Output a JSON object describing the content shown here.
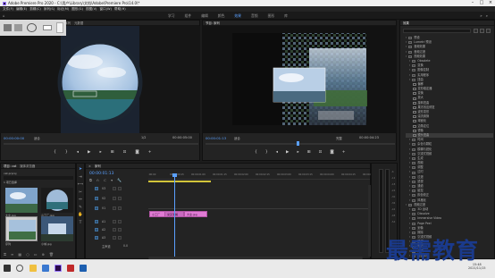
{
  "app": {
    "title": "Adobe Premiere Pro 2020 - C:\\用户\\Library\\文档\\Adobe\\Premiere Pro\\14.0\\*",
    "menu": [
      "文件(F)",
      "编辑(E)",
      "剪辑(C)",
      "序列(S)",
      "标记(M)",
      "图形(G)",
      "视图(V)",
      "窗口(W)",
      "帮助(H)"
    ]
  },
  "workspaces": {
    "tabs": [
      "学习",
      "组件",
      "编辑",
      "颜色",
      "效果",
      "音频",
      "图形",
      "库"
    ],
    "active_index": 4
  },
  "source": {
    "tabs": [
      "源：(无剪辑)",
      "效果控件",
      "音频剪辑混合器：序列",
      "元数据"
    ],
    "timecode_left": "00:00:00:00",
    "fit": "适合",
    "fraction": "1/2",
    "timecode_right": "00:00:05:00"
  },
  "program": {
    "tab": "节目: 序列",
    "timecode_left": "00:00:01:13",
    "fit": "适合",
    "fraction": "完整",
    "timecode_right": "00:00:04:23"
  },
  "effects": {
    "tab": "效果",
    "tree": [
      {
        "label": "预设",
        "kind": "folder",
        "level": 0
      },
      {
        "label": "Lumetri 预设",
        "kind": "folder",
        "level": 0
      },
      {
        "label": "音频效果",
        "kind": "folder",
        "level": 0
      },
      {
        "label": "音频过渡",
        "kind": "folder",
        "level": 0
      },
      {
        "label": "视频效果",
        "kind": "folder",
        "level": 0
      },
      {
        "label": "Obsolete",
        "kind": "folder",
        "level": 1
      },
      {
        "label": "变换",
        "kind": "folder",
        "level": 1
      },
      {
        "label": "图像控制",
        "kind": "folder",
        "level": 1
      },
      {
        "label": "实用程序",
        "kind": "folder",
        "level": 1
      },
      {
        "label": "扭曲",
        "kind": "folder",
        "level": 1
      },
      {
        "label": "偏移",
        "kind": "item",
        "level": 2
      },
      {
        "label": "变形稳定器",
        "kind": "item",
        "level": 2
      },
      {
        "label": "变换",
        "kind": "item",
        "level": 2
      },
      {
        "label": "放大",
        "kind": "item",
        "level": 2
      },
      {
        "label": "旋转扭曲",
        "kind": "item",
        "level": 2
      },
      {
        "label": "果冻效应修复",
        "kind": "item",
        "level": 2
      },
      {
        "label": "波形变形",
        "kind": "item",
        "level": 2
      },
      {
        "label": "湍流置换",
        "kind": "item",
        "level": 2
      },
      {
        "label": "球面化",
        "kind": "item",
        "level": 2
      },
      {
        "label": "边角定位",
        "kind": "item",
        "level": 2
      },
      {
        "label": "镜像",
        "kind": "item",
        "level": 2
      },
      {
        "label": "镜头扭曲",
        "kind": "item",
        "level": 2,
        "selected": true
      },
      {
        "label": "时间",
        "kind": "folder",
        "level": 1
      },
      {
        "label": "杂色与颗粒",
        "kind": "folder",
        "level": 1
      },
      {
        "label": "模糊与锐化",
        "kind": "folder",
        "level": 1
      },
      {
        "label": "沉浸式视频",
        "kind": "folder",
        "level": 1
      },
      {
        "label": "生成",
        "kind": "folder",
        "level": 1
      },
      {
        "label": "视频",
        "kind": "folder",
        "level": 1
      },
      {
        "label": "调整",
        "kind": "folder",
        "level": 1
      },
      {
        "label": "过时",
        "kind": "folder",
        "level": 1
      },
      {
        "label": "过渡",
        "kind": "folder",
        "level": 1
      },
      {
        "label": "透视",
        "kind": "folder",
        "level": 1
      },
      {
        "label": "通道",
        "kind": "folder",
        "level": 1
      },
      {
        "label": "键控",
        "kind": "folder",
        "level": 1
      },
      {
        "label": "颜色校正",
        "kind": "folder",
        "level": 1
      },
      {
        "label": "风格化",
        "kind": "folder",
        "level": 1
      },
      {
        "label": "视频过渡",
        "kind": "folder",
        "level": 0
      },
      {
        "label": "3D 运动",
        "kind": "folder",
        "level": 1
      },
      {
        "label": "Dissolve",
        "kind": "folder",
        "level": 1
      },
      {
        "label": "Immersive Video",
        "kind": "folder",
        "level": 1
      },
      {
        "label": "Page Peel",
        "kind": "folder",
        "level": 1
      },
      {
        "label": "划像",
        "kind": "folder",
        "level": 1
      },
      {
        "label": "擦除",
        "kind": "folder",
        "level": 1
      },
      {
        "label": "沉浸式视频",
        "kind": "folder",
        "level": 1
      },
      {
        "label": "溶解",
        "kind": "folder",
        "level": 1
      },
      {
        "label": "缩放",
        "kind": "folder",
        "level": 1
      },
      {
        "label": "内滑",
        "kind": "folder",
        "level": 1
      },
      {
        "label": "页面剥落",
        "kind": "folder",
        "level": 1
      }
    ]
  },
  "project": {
    "tabs": [
      "项目: cat",
      "媒体浏览器"
    ],
    "path": "cat.prproj",
    "count": "1 项已选择",
    "items": [
      {
        "label": "大全.jpg"
      },
      {
        "label": "小工厂.jpg"
      },
      {
        "label": "序列"
      },
      {
        "label": "小城.jpg"
      }
    ]
  },
  "timeline": {
    "tab": "序列",
    "timecode": "00:00:01:13",
    "ruler": [
      ":00:00",
      "00:00:00:15",
      "00:00:01:00",
      "00:00:01:15",
      "00:00:02:00",
      "00:00:02:15",
      "00:00:03:00",
      "00:00:03:15",
      "00:00:04:00",
      "00:00:04:15",
      "00:00:05:00"
    ],
    "tracks": [
      {
        "name": "V3"
      },
      {
        "name": "V2"
      },
      {
        "name": "V1"
      },
      {
        "name": "A1"
      },
      {
        "name": "A2"
      },
      {
        "name": "A3"
      }
    ],
    "master_label": "主声道",
    "master_value": "0.0",
    "clips": [
      {
        "label": "小工厂"
      },
      {
        "label": "交叉溶解"
      },
      {
        "label": "大全.jpg"
      }
    ]
  },
  "taskbar": {
    "time": "15:48",
    "date": "2021/11/15"
  },
  "watermark": "最需教育"
}
